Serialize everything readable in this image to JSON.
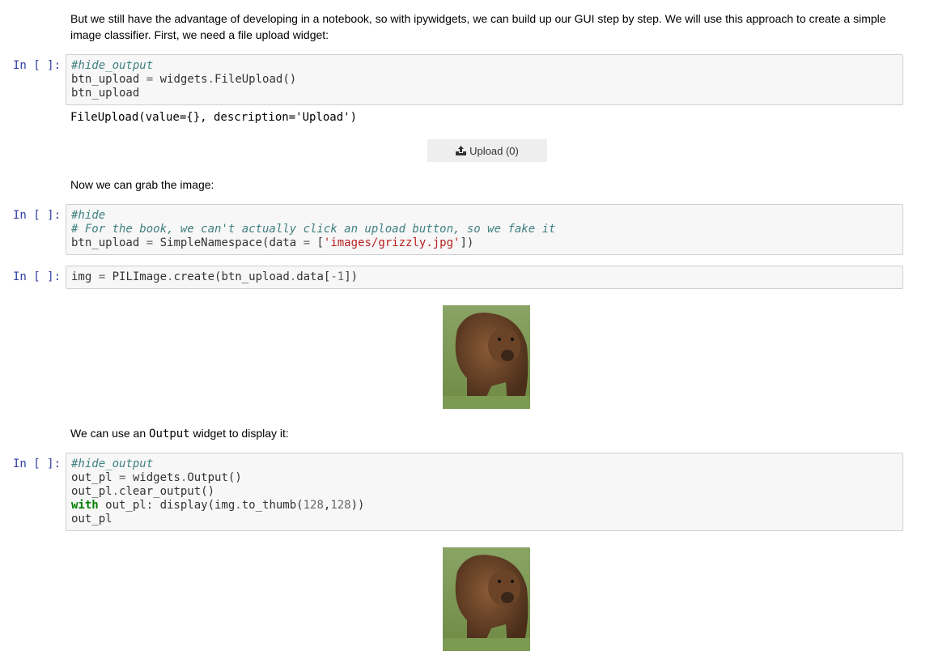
{
  "paragraphs": {
    "p1": "But we still have the advantage of developing in a notebook, so with ipywidgets, we can build up our GUI step by step. We will use this approach to create a simple image classifier. First, we need a file upload widget:",
    "p2": "Now we can grab the image:",
    "p3_before": "We can use an ",
    "p3_code": "Output",
    "p3_after": " widget to display it:"
  },
  "prompt": "In [ ]:",
  "cells": [
    [
      [
        {
          "t": "#hide_output",
          "k": "comment"
        }
      ],
      [
        {
          "t": "btn_upload "
        },
        {
          "t": "=",
          "k": "op"
        },
        {
          "t": " widgets"
        },
        {
          "t": ".",
          "k": "op"
        },
        {
          "t": "FileUpload()"
        }
      ],
      [
        {
          "t": "btn_upload"
        }
      ]
    ],
    [
      [
        {
          "t": "#hide",
          "k": "comment"
        }
      ],
      [
        {
          "t": "# For the book, we can't actually click an upload button, so we fake it",
          "k": "comment"
        }
      ],
      [
        {
          "t": "btn_upload "
        },
        {
          "t": "=",
          "k": "op"
        },
        {
          "t": " SimpleNamespace(data "
        },
        {
          "t": "=",
          "k": "op"
        },
        {
          "t": " ["
        },
        {
          "t": "'images/grizzly.jpg'",
          "k": "str"
        },
        {
          "t": "])"
        }
      ]
    ],
    [
      [
        {
          "t": "img "
        },
        {
          "t": "=",
          "k": "op"
        },
        {
          "t": " PILImage"
        },
        {
          "t": ".",
          "k": "op"
        },
        {
          "t": "create(btn_upload"
        },
        {
          "t": ".",
          "k": "op"
        },
        {
          "t": "data["
        },
        {
          "t": "-1",
          "k": "num"
        },
        {
          "t": "])"
        }
      ]
    ],
    [
      [
        {
          "t": "#hide_output",
          "k": "comment"
        }
      ],
      [
        {
          "t": "out_pl "
        },
        {
          "t": "=",
          "k": "op"
        },
        {
          "t": " widgets"
        },
        {
          "t": ".",
          "k": "op"
        },
        {
          "t": "Output()"
        }
      ],
      [
        {
          "t": "out_pl"
        },
        {
          "t": ".",
          "k": "op"
        },
        {
          "t": "clear_output()"
        }
      ],
      [
        {
          "t": "with",
          "k": "kw"
        },
        {
          "t": " out_pl: display(img"
        },
        {
          "t": ".",
          "k": "op"
        },
        {
          "t": "to_thumb("
        },
        {
          "t": "128",
          "k": "num"
        },
        {
          "t": ","
        },
        {
          "t": "128",
          "k": "num"
        },
        {
          "t": "))"
        }
      ],
      [
        {
          "t": "out_pl"
        }
      ]
    ]
  ],
  "output1": "FileUpload(value={}, description='Upload')",
  "upload_button": {
    "icon": "upload-icon",
    "label": "Upload (0)"
  },
  "images": [
    "grizzly-bear-image",
    "grizzly-bear-thumbnail"
  ]
}
